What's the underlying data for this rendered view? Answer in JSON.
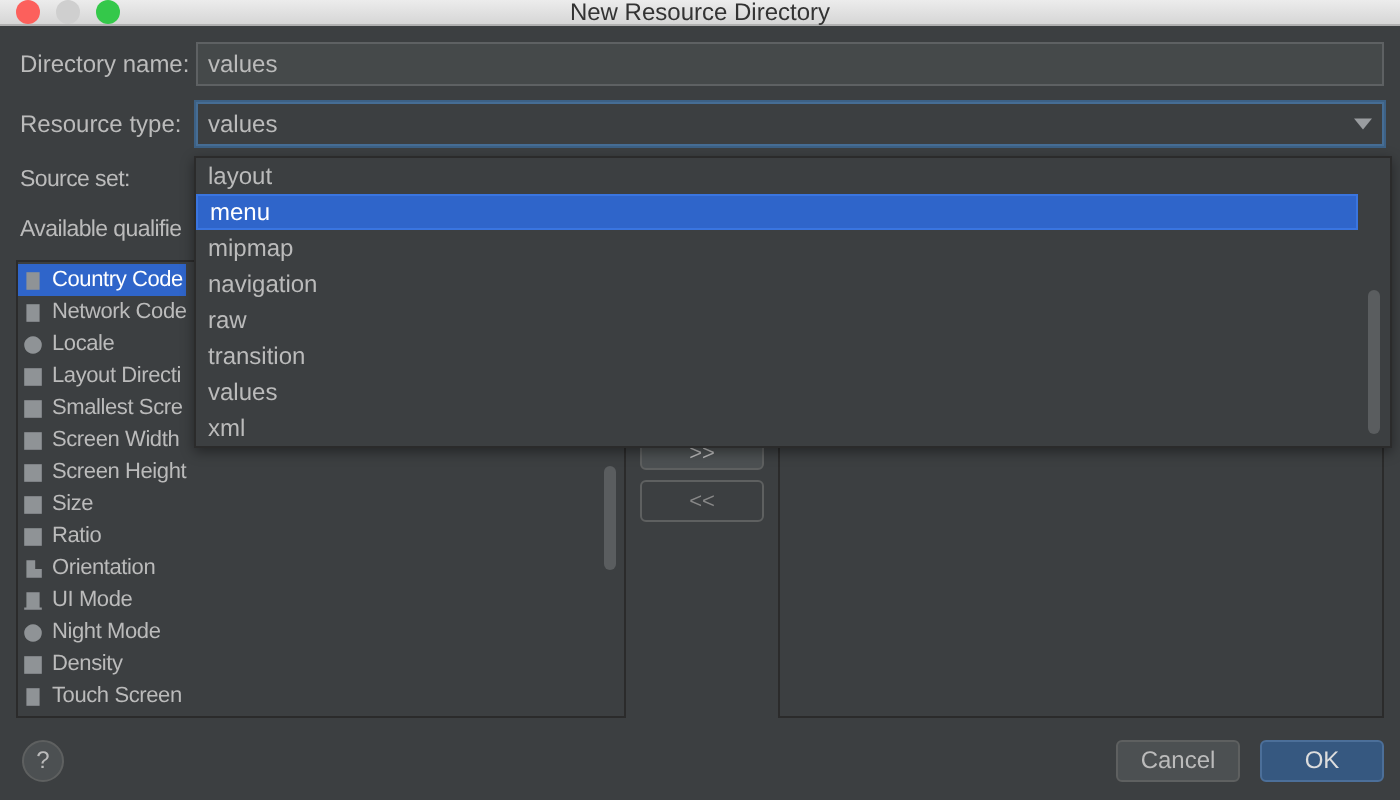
{
  "window": {
    "title": "New Resource Directory"
  },
  "directory_name": {
    "label": "Directory name:",
    "value": "values"
  },
  "resource_type": {
    "label": "Resource type:",
    "value": "values",
    "expanded": true
  },
  "resource_type_options": [
    {
      "label": "layout",
      "selected": false
    },
    {
      "label": "menu",
      "selected": true
    },
    {
      "label": "mipmap",
      "selected": false
    },
    {
      "label": "navigation",
      "selected": false
    },
    {
      "label": "raw",
      "selected": false
    },
    {
      "label": "transition",
      "selected": false
    },
    {
      "label": "values",
      "selected": false
    },
    {
      "label": "xml",
      "selected": false
    }
  ],
  "source_set": {
    "label": "Source set:"
  },
  "available_qualifiers": {
    "label": "Available qualifie",
    "items": [
      {
        "label": "Country Code",
        "selected": true
      },
      {
        "label": "Network Code",
        "selected": false
      },
      {
        "label": "Locale",
        "selected": false
      },
      {
        "label": "Layout Directi",
        "selected": false
      },
      {
        "label": "Smallest Scre",
        "selected": false
      },
      {
        "label": "Screen Width",
        "selected": false
      },
      {
        "label": "Screen Height",
        "selected": false
      },
      {
        "label": "Size",
        "selected": false
      },
      {
        "label": "Ratio",
        "selected": false
      },
      {
        "label": "Orientation",
        "selected": false
      },
      {
        "label": "UI Mode",
        "selected": false
      },
      {
        "label": "Night Mode",
        "selected": false
      },
      {
        "label": "Density",
        "selected": false
      },
      {
        "label": "Touch Screen",
        "selected": false
      }
    ]
  },
  "move_buttons": [
    ">>",
    "<<"
  ],
  "help_button": "?",
  "buttons": [
    {
      "label": "Cancel",
      "kind": "normal"
    },
    {
      "label": "OK",
      "kind": "default"
    }
  ]
}
